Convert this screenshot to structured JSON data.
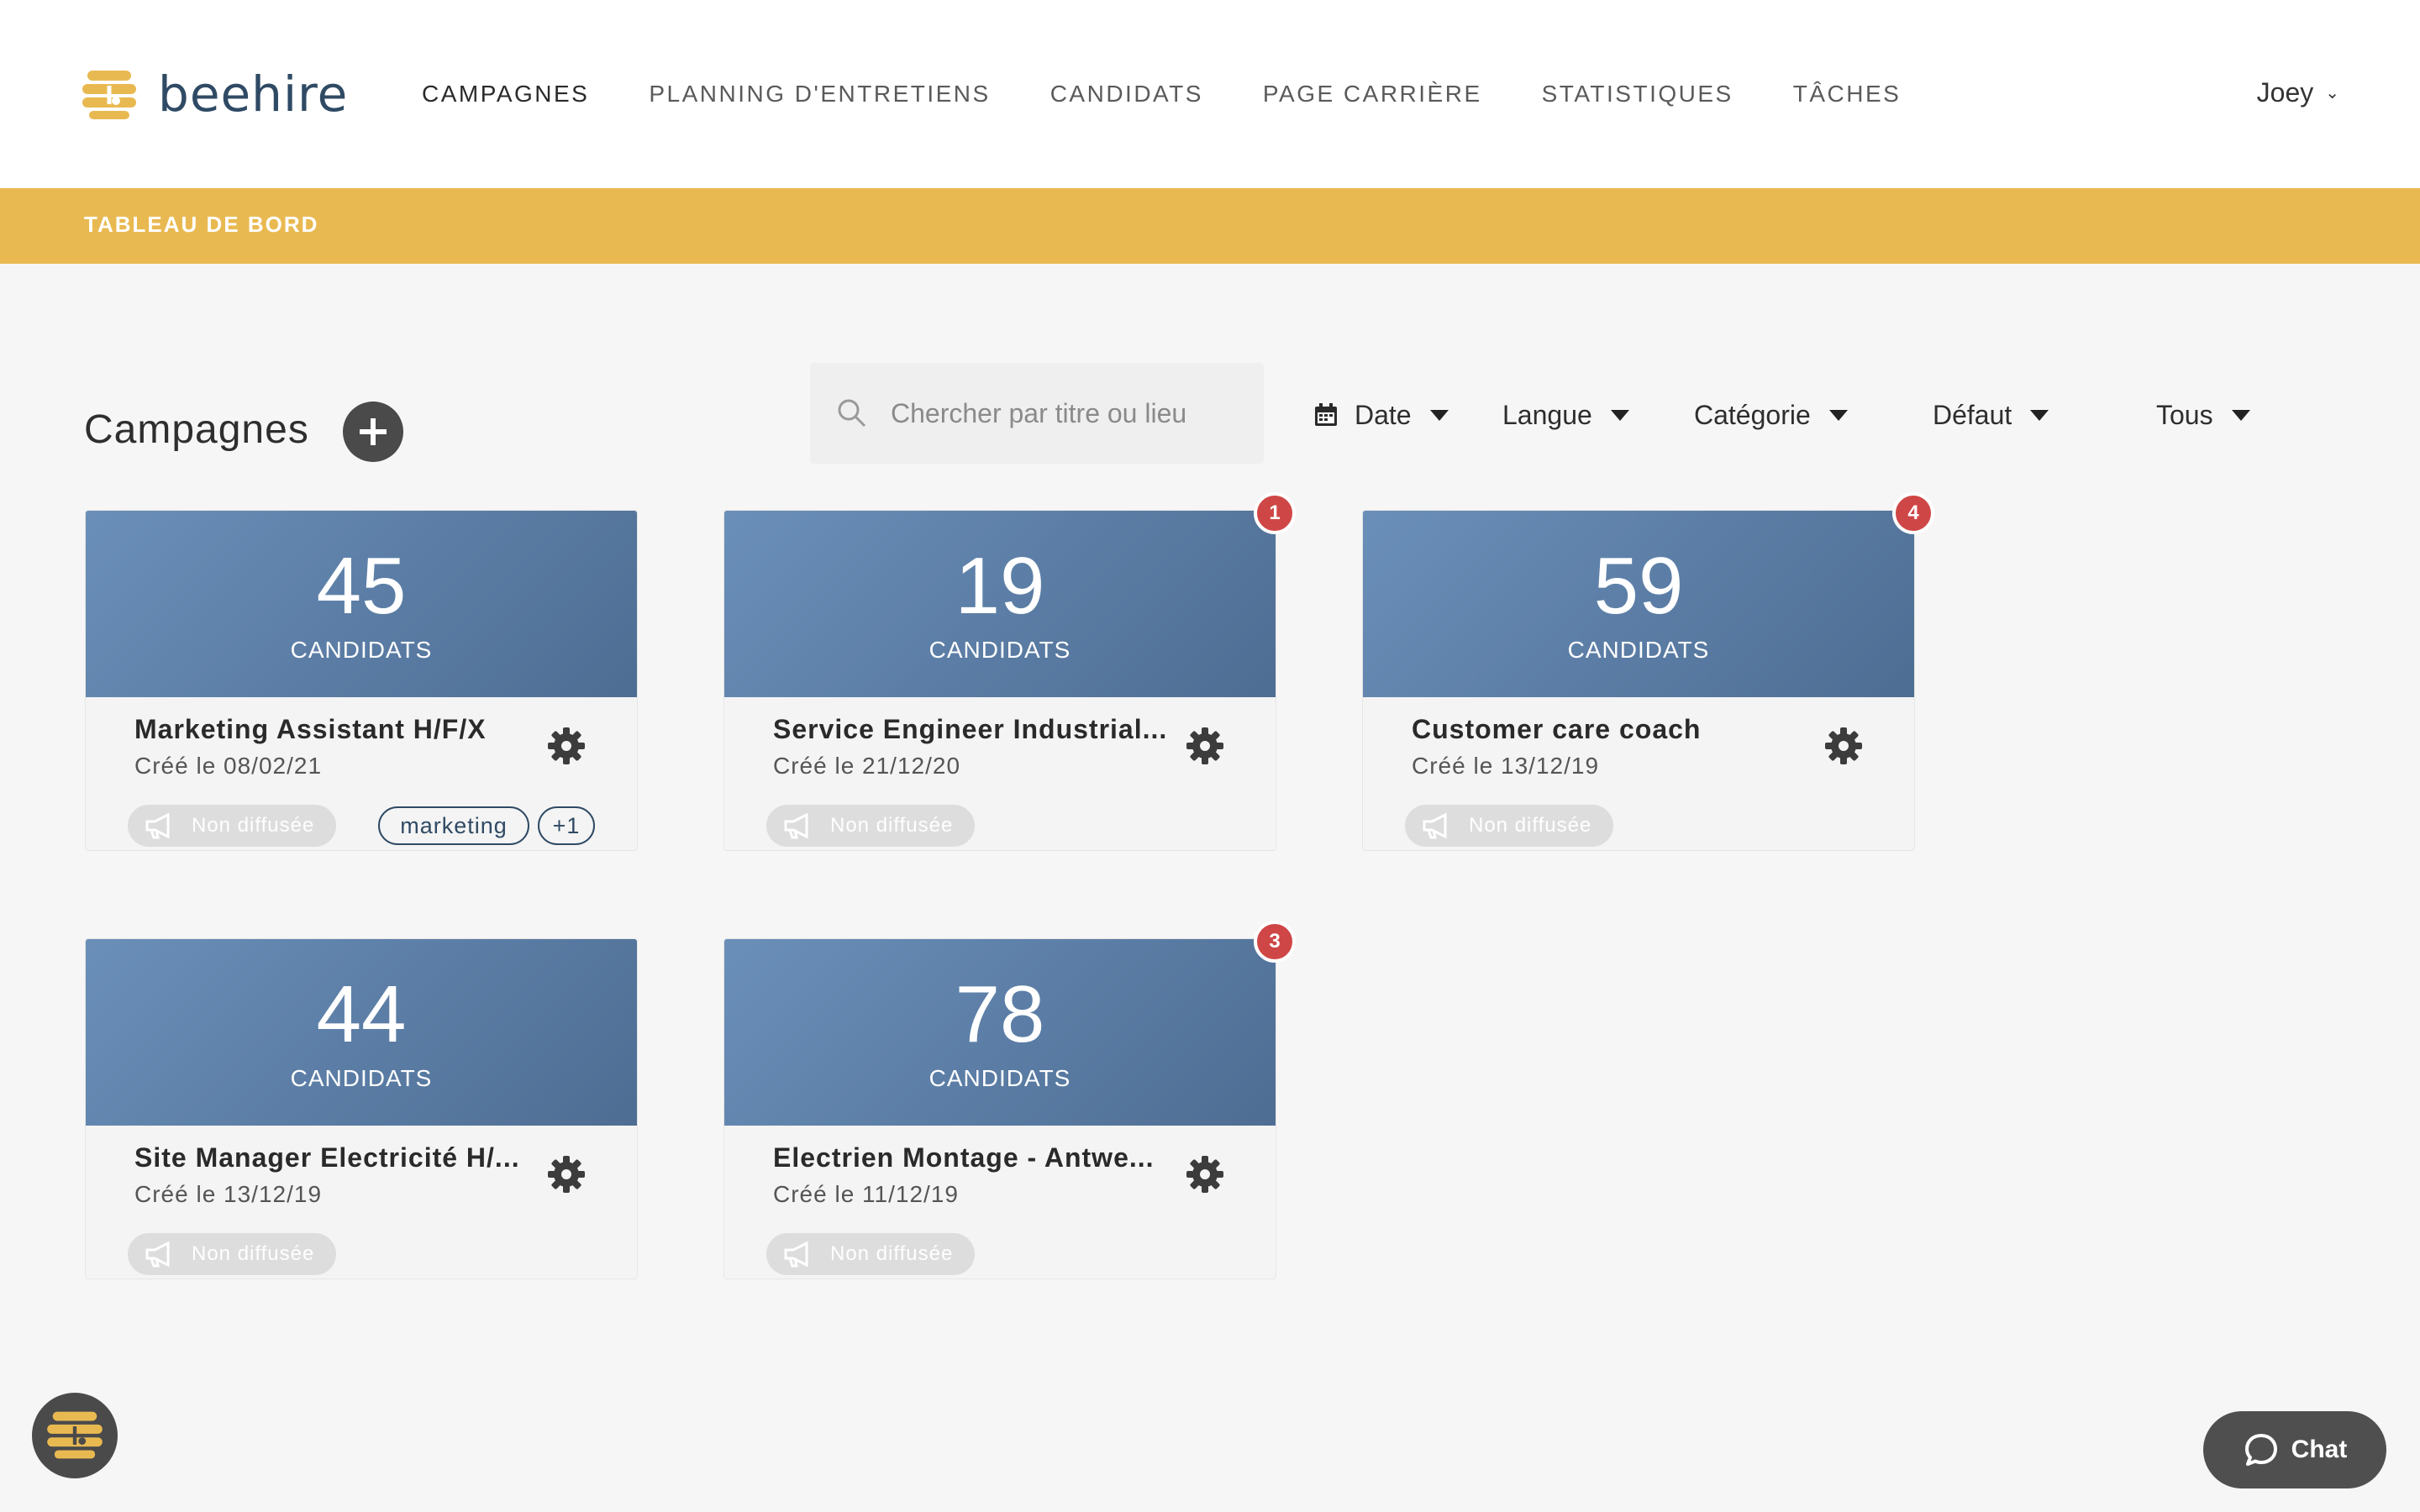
{
  "brand": {
    "name": "beehire",
    "primary": "#2f4a64",
    "accent": "#e9b951"
  },
  "nav": {
    "items": [
      {
        "label": "CAMPAGNES",
        "active": true
      },
      {
        "label": "PLANNING D'ENTRETIENS"
      },
      {
        "label": "CANDIDATS"
      },
      {
        "label": "PAGE CARRIÈRE"
      },
      {
        "label": "STATISTIQUES"
      },
      {
        "label": "TÂCHES"
      }
    ],
    "user": "Joey"
  },
  "breadcrumb": {
    "title": "TABLEAU DE BORD"
  },
  "section": {
    "title": "Campagnes"
  },
  "search": {
    "placeholder": "Chercher par titre ou lieu"
  },
  "filters": {
    "date": "Date",
    "language": "Langue",
    "category": "Catégorie",
    "sort": "Défaut",
    "status": "Tous"
  },
  "campaigns": [
    {
      "count": "45",
      "count_label": "CANDIDATS",
      "title": "Marketing Assistant H/F/X",
      "created": "Créé le 08/02/21",
      "status": "Non diffusée",
      "tag": "marketing",
      "tag_more": "+1"
    },
    {
      "count": "19",
      "count_label": "CANDIDATS",
      "title": "Service Engineer Industrial...",
      "created": "Créé le 21/12/20",
      "status": "Non diffusée",
      "badge": "1"
    },
    {
      "count": "59",
      "count_label": "CANDIDATS",
      "title": "Customer care coach",
      "created": "Créé le 13/12/19",
      "status": "Non diffusée",
      "badge": "4"
    },
    {
      "count": "44",
      "count_label": "CANDIDATS",
      "title": "Site Manager Electricité H/...",
      "created": "Créé le 13/12/19",
      "status": "Non diffusée"
    },
    {
      "count": "78",
      "count_label": "CANDIDATS",
      "title": "Electrien Montage - Antwe...",
      "created": "Créé le 11/12/19",
      "status": "Non diffusée",
      "badge": "3"
    }
  ],
  "chat": {
    "label": "Chat"
  },
  "icons": {
    "logo": "bee-logo-icon",
    "search": "search-icon",
    "calendar": "calendar-icon",
    "settings": "gear-icon",
    "broadcast": "megaphone-icon",
    "add": "plus-icon",
    "chat": "chat-bubble-icon"
  }
}
